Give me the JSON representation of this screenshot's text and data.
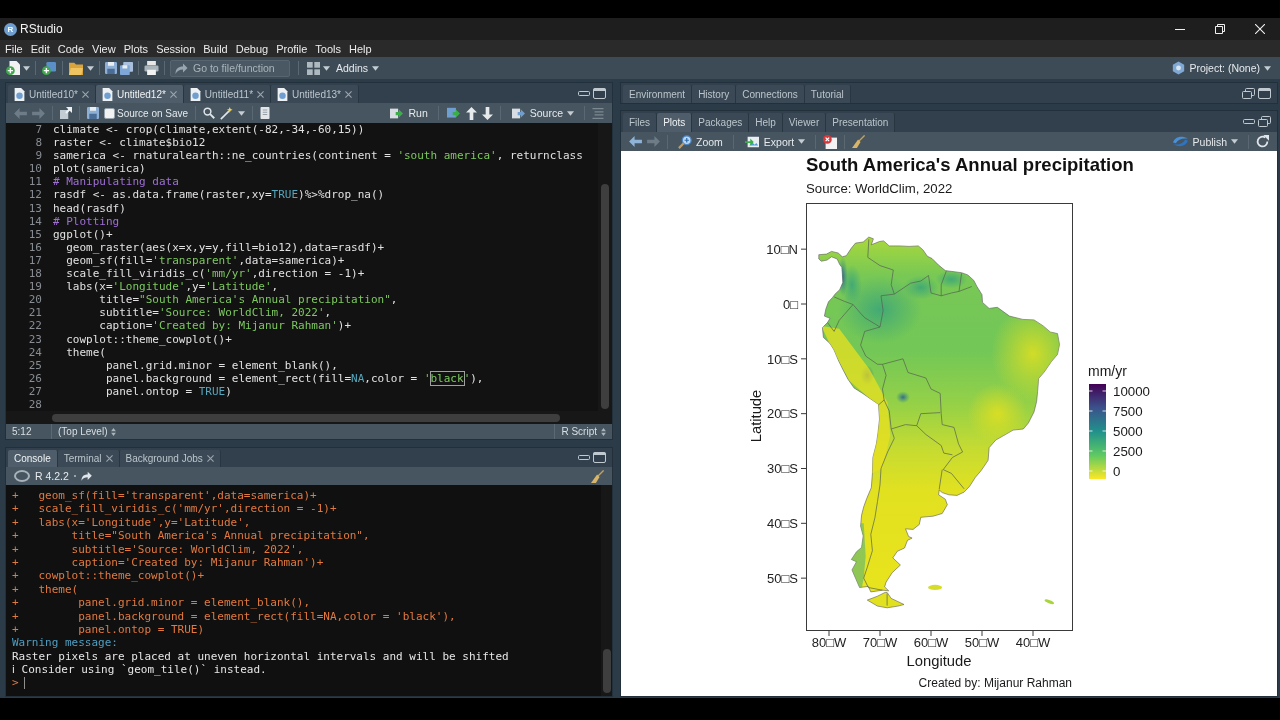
{
  "window": {
    "logo": "R",
    "title": "RStudio"
  },
  "menu": [
    "File",
    "Edit",
    "Code",
    "View",
    "Plots",
    "Session",
    "Build",
    "Debug",
    "Profile",
    "Tools",
    "Help"
  ],
  "toolbar": {
    "go_to": {
      "placeholder": "Go to file/function"
    },
    "addins": "Addins",
    "project": "Project: (None)"
  },
  "editor": {
    "tabs": [
      {
        "label": "Untitled10*",
        "selected": false
      },
      {
        "label": "Untitled12*",
        "selected": true
      },
      {
        "label": "Untitled11*",
        "selected": false
      },
      {
        "label": "Untitled13*",
        "selected": false
      }
    ],
    "source_on_save": {
      "label": "Source on Save",
      "checked": false
    },
    "run": "Run",
    "source": "Source",
    "lines": [
      {
        "number": "7",
        "tokens": [
          {
            "kind": "plain",
            "text": "climate <- crop(climate,extent(-82,-34,-60,15))"
          }
        ]
      },
      {
        "number": "8",
        "tokens": [
          {
            "kind": "plain",
            "text": "raster <- climate$bio12"
          }
        ]
      },
      {
        "number": "9",
        "tokens": [
          {
            "kind": "plain",
            "text": "samerica <- rnaturalearth::ne_countries(continent = "
          },
          {
            "kind": "string",
            "text": "'south america'"
          },
          {
            "kind": "plain",
            "text": ", returnclass"
          }
        ]
      },
      {
        "number": "10",
        "tokens": [
          {
            "kind": "plain",
            "text": "plot(samerica)"
          }
        ]
      },
      {
        "number": "11",
        "tokens": [
          {
            "kind": "comment",
            "text": "# Manipulating data"
          }
        ]
      },
      {
        "number": "12",
        "tokens": [
          {
            "kind": "plain",
            "text": "rasdf <- as.data.frame(raster,xy="
          },
          {
            "kind": "constant",
            "text": "TRUE"
          },
          {
            "kind": "plain",
            "text": ")%>%drop_na()"
          }
        ]
      },
      {
        "number": "13",
        "tokens": [
          {
            "kind": "plain",
            "text": "head(rasdf)"
          }
        ]
      },
      {
        "number": "14",
        "tokens": [
          {
            "kind": "comment",
            "text": "# Plotting"
          }
        ]
      },
      {
        "number": "15",
        "tokens": [
          {
            "kind": "plain",
            "text": "ggplot()+"
          }
        ]
      },
      {
        "number": "16",
        "tokens": [
          {
            "kind": "plain",
            "text": "  geom_raster(aes(x=x,y=y,fill=bio12),data=rasdf)+"
          }
        ]
      },
      {
        "number": "17",
        "tokens": [
          {
            "kind": "plain",
            "text": "  geom_sf(fill="
          },
          {
            "kind": "string",
            "text": "'transparent'"
          },
          {
            "kind": "plain",
            "text": ",data=samerica)+"
          }
        ]
      },
      {
        "number": "18",
        "tokens": [
          {
            "kind": "plain",
            "text": "  scale_fill_viridis_c("
          },
          {
            "kind": "string",
            "text": "'mm/yr'"
          },
          {
            "kind": "plain",
            "text": ",direction = -1)+"
          }
        ]
      },
      {
        "number": "19",
        "tokens": [
          {
            "kind": "plain",
            "text": "  labs(x="
          },
          {
            "kind": "string",
            "text": "'Longitude'"
          },
          {
            "kind": "plain",
            "text": ",y="
          },
          {
            "kind": "string",
            "text": "'Latitude'"
          },
          {
            "kind": "plain",
            "text": ","
          }
        ]
      },
      {
        "number": "20",
        "tokens": [
          {
            "kind": "plain",
            "text": "       title="
          },
          {
            "kind": "string",
            "text": "\"South America's Annual precipitation\""
          },
          {
            "kind": "plain",
            "text": ","
          }
        ]
      },
      {
        "number": "21",
        "tokens": [
          {
            "kind": "plain",
            "text": "       subtitle="
          },
          {
            "kind": "string",
            "text": "'Source: WorldClim, 2022'"
          },
          {
            "kind": "plain",
            "text": ","
          }
        ]
      },
      {
        "number": "22",
        "tokens": [
          {
            "kind": "plain",
            "text": "       caption="
          },
          {
            "kind": "string",
            "text": "'Created by: Mijanur Rahman'"
          },
          {
            "kind": "plain",
            "text": ")+"
          }
        ]
      },
      {
        "number": "23",
        "tokens": [
          {
            "kind": "plain",
            "text": "  cowplot::theme_cowplot()+"
          }
        ]
      },
      {
        "number": "24",
        "tokens": [
          {
            "kind": "plain",
            "text": "  theme("
          }
        ]
      },
      {
        "number": "25",
        "tokens": [
          {
            "kind": "plain",
            "text": "        panel.grid.minor = element_blank(),"
          }
        ]
      },
      {
        "number": "26",
        "tokens": [
          {
            "kind": "plain",
            "text": "        panel.background = element_rect(fill="
          },
          {
            "kind": "constant",
            "text": "NA"
          },
          {
            "kind": "plain",
            "text": ",color = "
          },
          {
            "kind": "string",
            "text": "'"
          },
          {
            "kind": "match",
            "text": "black"
          },
          {
            "kind": "string",
            "text": "'"
          },
          {
            "kind": "plain",
            "text": "),"
          }
        ]
      },
      {
        "number": "27",
        "tokens": [
          {
            "kind": "plain",
            "text": "        panel.ontop = "
          },
          {
            "kind": "constant",
            "text": "TRUE"
          },
          {
            "kind": "plain",
            "text": ")"
          }
        ]
      },
      {
        "number": "28"
      }
    ],
    "status": {
      "position": "5:12",
      "scope": "(Top Level)",
      "file_type": "R Script"
    }
  },
  "console": {
    "tabs": [
      {
        "label": "Console",
        "selected": true,
        "closable": false
      },
      {
        "label": "Terminal",
        "selected": false,
        "closable": true
      },
      {
        "label": "Background Jobs",
        "selected": false,
        "closable": true
      }
    ],
    "version": "R 4.2.2",
    "lines": [
      {
        "kind": "input",
        "text": "+   geom_sf(fill='transparent',data=samerica)+"
      },
      {
        "kind": "input",
        "text": "+   scale_fill_viridis_c('mm/yr',direction = -1)+"
      },
      {
        "kind": "input",
        "text": "+   labs(x='Longitude',y='Latitude',"
      },
      {
        "kind": "input",
        "text": "+        title=\"South America's Annual precipitation\","
      },
      {
        "kind": "input",
        "text": "+        subtitle='Source: WorldClim, 2022',"
      },
      {
        "kind": "input",
        "text": "+        caption='Created by: Mijanur Rahman')+"
      },
      {
        "kind": "input",
        "text": "+   cowplot::theme_cowplot()+"
      },
      {
        "kind": "input",
        "text": "+   theme("
      },
      {
        "kind": "input",
        "text": "+         panel.grid.minor = element_blank(),"
      },
      {
        "kind": "input",
        "text": "+         panel.background = element_rect(fill=NA,color = 'black'),"
      },
      {
        "kind": "input",
        "text": "+         panel.ontop = TRUE)"
      },
      {
        "kind": "warning",
        "text": "Warning message:"
      },
      {
        "kind": "output",
        "text": "Raster pixels are placed at uneven horizontal intervals and will be shifted"
      },
      {
        "kind": "output",
        "text": "ℹ Consider using `geom_tile()` instead."
      },
      {
        "kind": "prompt",
        "text": ">"
      }
    ]
  },
  "environment_pane": {
    "tabs": [
      {
        "label": "Environment",
        "selected": false
      },
      {
        "label": "History",
        "selected": false
      },
      {
        "label": "Connections",
        "selected": false
      },
      {
        "label": "Tutorial",
        "selected": false
      }
    ]
  },
  "files_pane": {
    "tabs": [
      {
        "label": "Files",
        "selected": false
      },
      {
        "label": "Plots",
        "selected": true
      },
      {
        "label": "Packages",
        "selected": false
      },
      {
        "label": "Help",
        "selected": false
      },
      {
        "label": "Viewer",
        "selected": false
      },
      {
        "label": "Presentation",
        "selected": false
      }
    ],
    "zoom": "Zoom",
    "export": "Export",
    "publish": "Publish",
    "plot": {
      "title": "South America's Annual precipitation",
      "subtitle": "Source: WorldClim, 2022",
      "y_ticks": [
        "10□N",
        "0□",
        "10□S",
        "20□S",
        "30□S",
        "40□S",
        "50□S"
      ],
      "x_ticks": [
        "80□W",
        "70□W",
        "60□W",
        "50□W",
        "40□W"
      ],
      "x_axis_title": "Longitude",
      "y_axis_title": "Latitude",
      "legend": {
        "title": "mm/yr",
        "labels": [
          "10000",
          "7500",
          "5000",
          "2500",
          "0"
        ]
      },
      "caption": "Created by: Mijanur Rahman"
    }
  }
}
